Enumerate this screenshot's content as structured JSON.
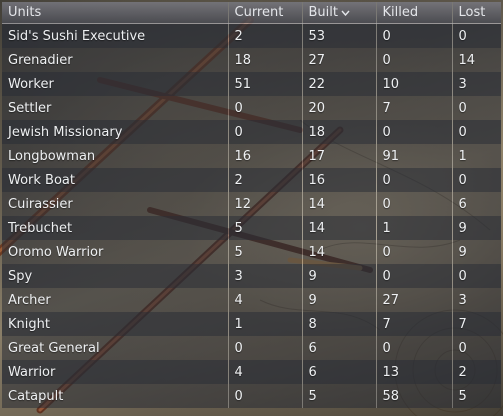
{
  "table": {
    "headers": {
      "units": "Units",
      "current": "Current",
      "built": "Built",
      "killed": "Killed",
      "lost": "Lost"
    },
    "sort_icon": "chevron-down-icon",
    "rows": [
      {
        "unit": "Sid's Sushi Executive",
        "current": "2",
        "built": "53",
        "killed": "0",
        "lost": "0"
      },
      {
        "unit": "Grenadier",
        "current": "18",
        "built": "27",
        "killed": "0",
        "lost": "14"
      },
      {
        "unit": "Worker",
        "current": "51",
        "built": "22",
        "killed": "10",
        "lost": "3"
      },
      {
        "unit": "Settler",
        "current": "0",
        "built": "20",
        "killed": "7",
        "lost": "0"
      },
      {
        "unit": "Jewish Missionary",
        "current": "0",
        "built": "18",
        "killed": "0",
        "lost": "0"
      },
      {
        "unit": "Longbowman",
        "current": "16",
        "built": "17",
        "killed": "91",
        "lost": "1"
      },
      {
        "unit": "Work Boat",
        "current": "2",
        "built": "16",
        "killed": "0",
        "lost": "0"
      },
      {
        "unit": "Cuirassier",
        "current": "12",
        "built": "14",
        "killed": "0",
        "lost": "6"
      },
      {
        "unit": "Trebuchet",
        "current": "5",
        "built": "14",
        "killed": "1",
        "lost": "9"
      },
      {
        "unit": "Oromo Warrior",
        "current": "5",
        "built": "14",
        "killed": "0",
        "lost": "9"
      },
      {
        "unit": "Spy",
        "current": "3",
        "built": "9",
        "killed": "0",
        "lost": "0"
      },
      {
        "unit": "Archer",
        "current": "4",
        "built": "9",
        "killed": "27",
        "lost": "3"
      },
      {
        "unit": "Knight",
        "current": "1",
        "built": "8",
        "killed": "7",
        "lost": "7"
      },
      {
        "unit": "Great General",
        "current": "0",
        "built": "6",
        "killed": "0",
        "lost": "0"
      },
      {
        "unit": "Warrior",
        "current": "4",
        "built": "6",
        "killed": "13",
        "lost": "2"
      },
      {
        "unit": "Catapult",
        "current": "0",
        "built": "5",
        "killed": "58",
        "lost": "5"
      }
    ]
  }
}
